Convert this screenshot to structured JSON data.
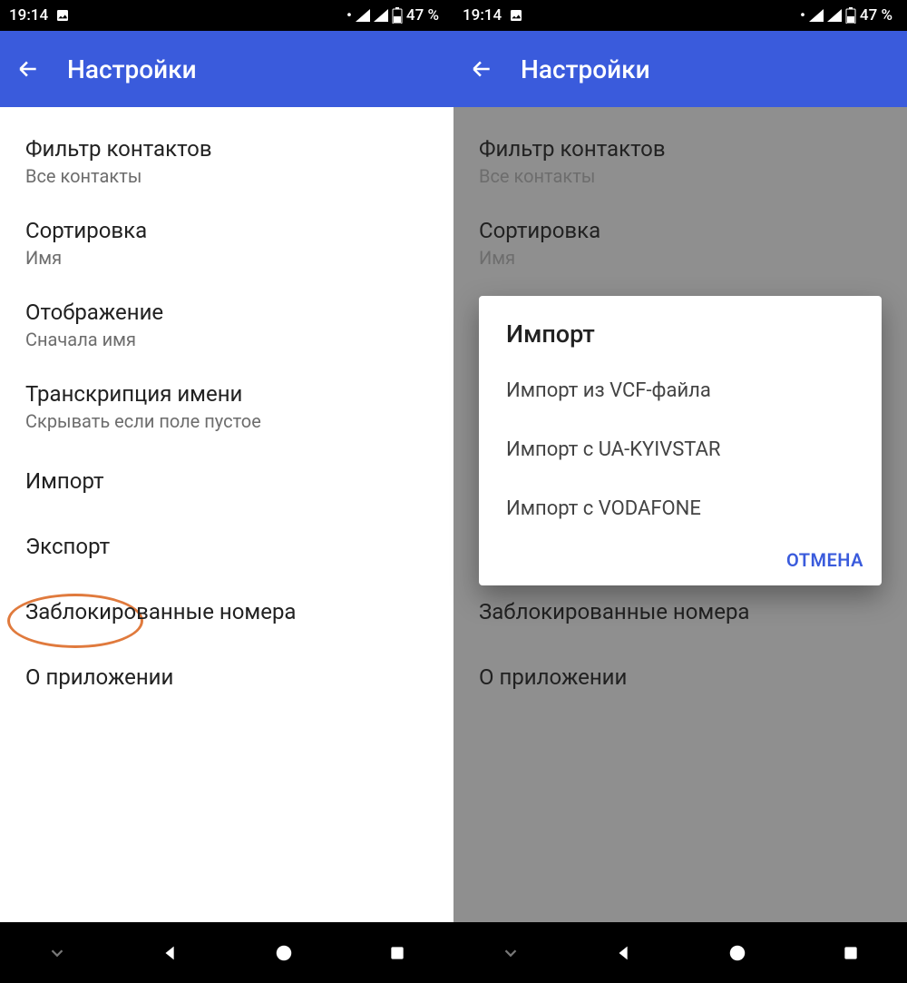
{
  "status": {
    "time": "19:14",
    "battery": "47 %"
  },
  "appbar": {
    "title": "Настройки"
  },
  "settings": {
    "filter": {
      "title": "Фильтр контактов",
      "sub": "Все контакты"
    },
    "sort": {
      "title": "Сортировка",
      "sub": "Имя"
    },
    "display": {
      "title": "Отображение",
      "sub": "Сначала имя"
    },
    "phonetic": {
      "title": "Транскрипция имени",
      "sub": "Скрывать если поле пустое"
    },
    "import": {
      "title": "Импорт"
    },
    "export": {
      "title": "Экспорт"
    },
    "blocked": {
      "title": "Заблокированные номера"
    },
    "about": {
      "title": "О приложении"
    }
  },
  "dialog": {
    "title": "Импорт",
    "opt_vcf": "Импорт из VCF-файла",
    "opt_kyiv": "Импорт с UA-KYIVSTAR",
    "opt_voda": "Импорт с VODAFONE",
    "cancel": "ОТМЕНА"
  }
}
